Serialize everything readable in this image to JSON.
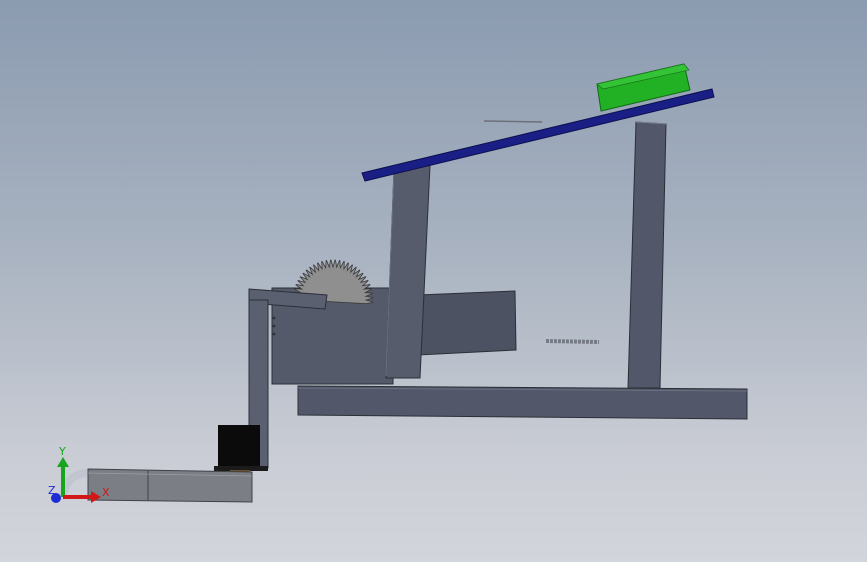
{
  "viewport": {
    "name": "3d-model-view"
  },
  "triad": {
    "x_label": "X",
    "y_label": "Y",
    "z_label": "Z",
    "x_color": "#d01818",
    "y_color": "#17a51d",
    "z_color": "#1e2cd6"
  },
  "colors": {
    "frame": "#4f5564",
    "frame_light": "#5d6372",
    "plate_blue": "#1a1f86",
    "green_block": "#23b125",
    "motor_black": "#0b0b0b",
    "gear_gray": "#8d8d8d"
  }
}
